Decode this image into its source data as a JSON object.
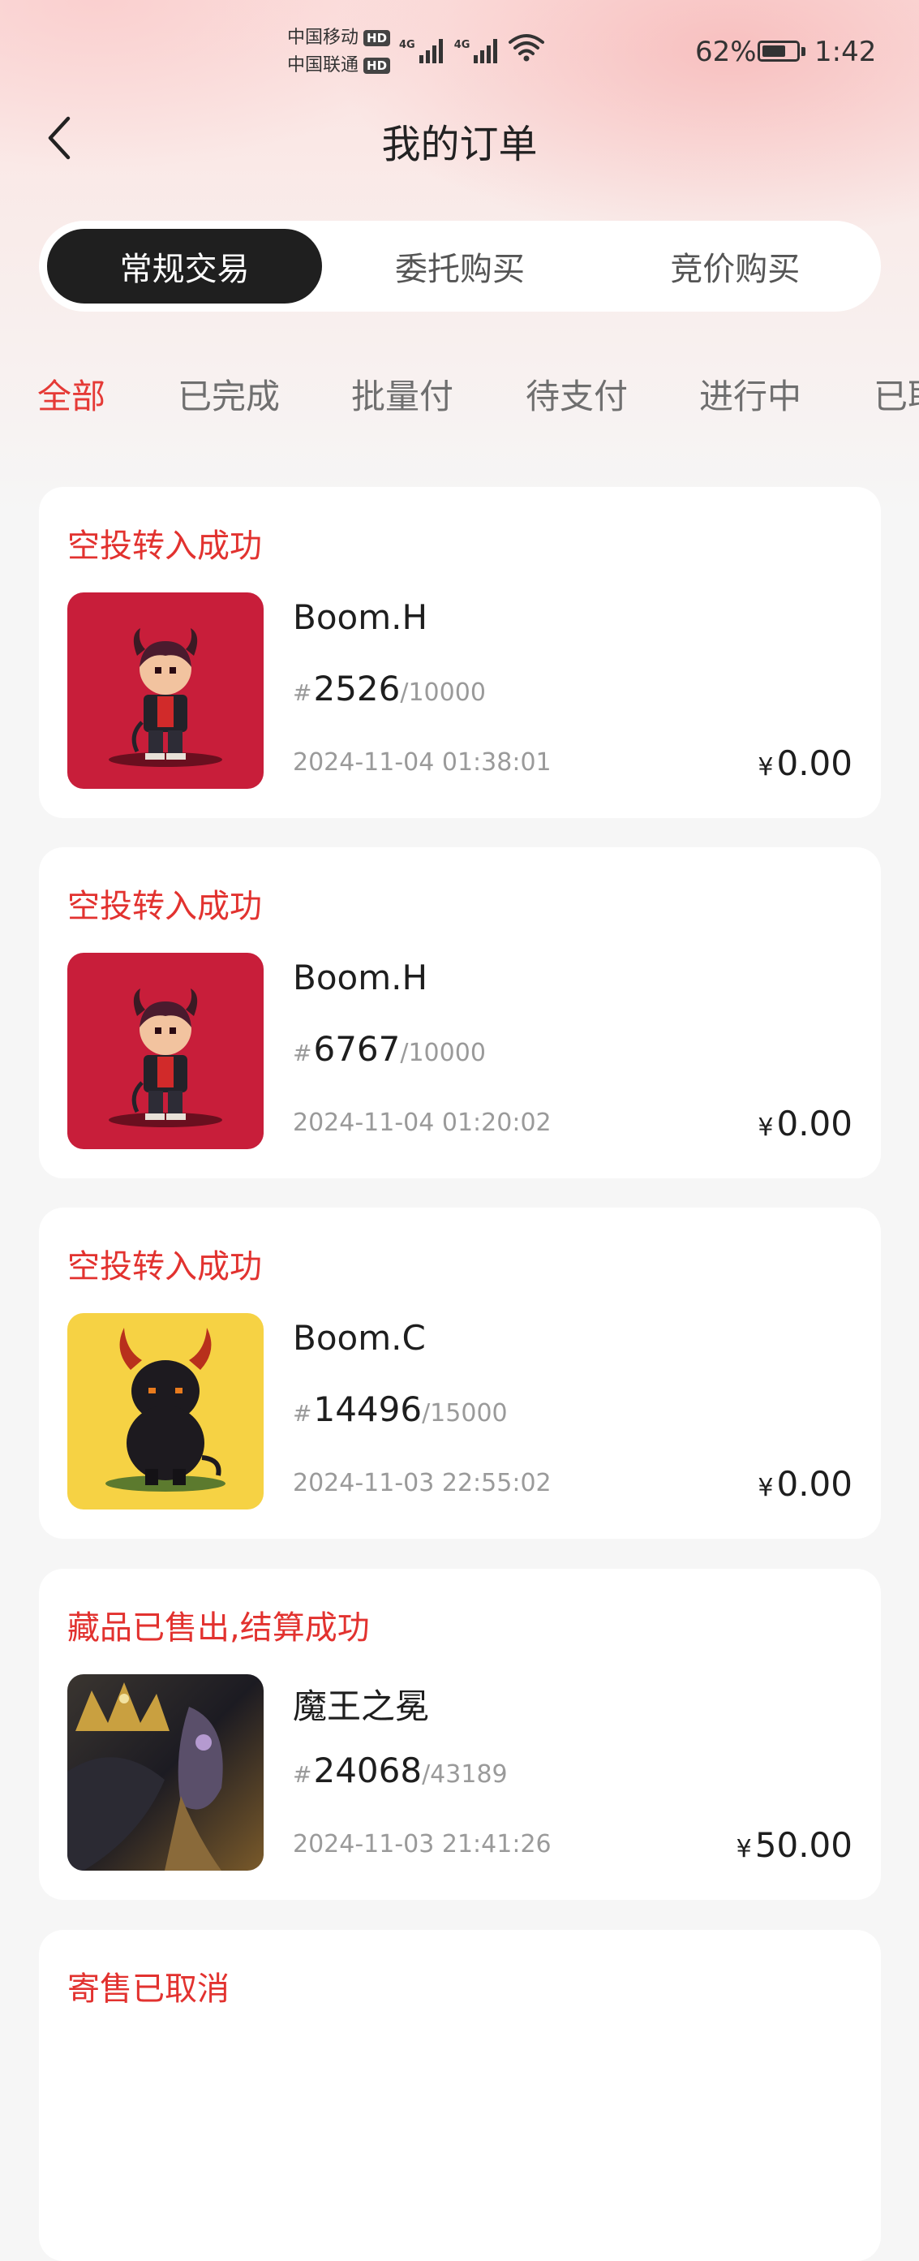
{
  "status_bar": {
    "carrier_1": "中国移动",
    "carrier_2": "中国联通",
    "hd_badge": "HD",
    "net_type": "4G",
    "battery_pct": "62%",
    "time": "1:42"
  },
  "header": {
    "title": "我的订单",
    "back_icon": "chevron-left-icon"
  },
  "segments": {
    "items": [
      "常规交易",
      "委托购买",
      "竞价购买"
    ],
    "active_index": 0
  },
  "filters": {
    "items": [
      "全部",
      "已完成",
      "批量付",
      "待支付",
      "进行中",
      "已取"
    ],
    "active_index": 0
  },
  "orders": [
    {
      "status": "空投转入成功",
      "name": "Boom.H",
      "hash": "#",
      "serial": "2526",
      "total": "/10000",
      "time": "2024-11-04 01:38:01",
      "currency": "¥",
      "price": "0.00",
      "thumb": "red-devil-boy"
    },
    {
      "status": "空投转入成功",
      "name": "Boom.H",
      "hash": "#",
      "serial": "6767",
      "total": "/10000",
      "time": "2024-11-04 01:20:02",
      "currency": "¥",
      "price": "0.00",
      "thumb": "red-devil-boy"
    },
    {
      "status": "空投转入成功",
      "name": "Boom.C",
      "hash": "#",
      "serial": "14496",
      "total": "/15000",
      "time": "2024-11-03 22:55:02",
      "currency": "¥",
      "price": "0.00",
      "thumb": "black-demon"
    },
    {
      "status": "藏品已售出,结算成功",
      "name": "魔王之冕",
      "hash": "#",
      "serial": "24068",
      "total": "/43189",
      "time": "2024-11-03 21:41:26",
      "currency": "¥",
      "price": "50.00",
      "thumb": "demon-king-crown"
    },
    {
      "status": "寄售已取消"
    }
  ],
  "colors": {
    "accent_red": "#e2322f",
    "segment_active_bg": "#1f1f1f",
    "thumb_red": "#c81e3a",
    "thumb_yellow": "#f6d244"
  }
}
